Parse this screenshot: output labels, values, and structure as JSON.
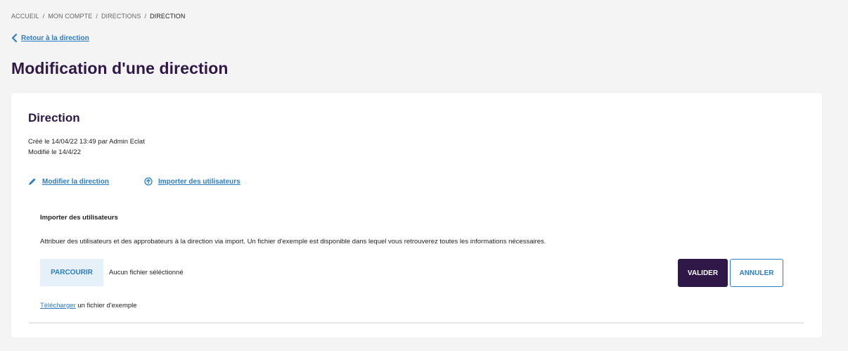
{
  "breadcrumb": {
    "items": [
      "ACCUEIL",
      "MON COMPTE",
      "DIRECTIONS",
      "DIRECTION"
    ],
    "separator": "/"
  },
  "back_link": {
    "label": "Retour à la direction",
    "icon": "chevron-left-icon"
  },
  "page_title": "Modification d'une direction",
  "card": {
    "title": "Direction",
    "created": "Créé le 14/04/22 13:49  par Admin Eclat",
    "modified": "Modifié le 14/4/22",
    "actions": {
      "edit_label": "Modifier la direction",
      "edit_icon": "pencil-icon",
      "import_label": "Importer des utilisateurs",
      "import_icon": "upload-circle-icon"
    }
  },
  "import_panel": {
    "title": "Importer des utilisateurs",
    "description": "Attribuer des utilisateurs et des approbateurs à la direction via import. Un fichier d'exemple est disponible dans lequel vous retrouverez toutes les informations nécessaires.",
    "browse_label": "PARCOURIR",
    "no_file_text": "Aucun fichier séléctionné",
    "validate_label": "VALIDER",
    "cancel_label": "ANNULER",
    "download_link": "Télécharger",
    "download_suffix": " un fichier d'exemple"
  },
  "colors": {
    "brand_dark": "#2f1847",
    "link_blue": "#2b7ec4",
    "browse_bg": "#e6f0f8",
    "page_bg": "#f4f4f5"
  }
}
